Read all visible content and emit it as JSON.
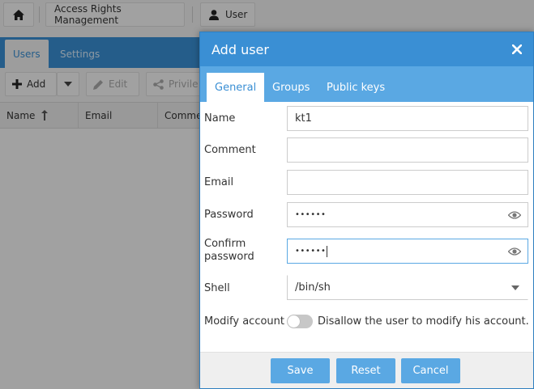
{
  "breadcrumb": {
    "home_icon": "home-icon",
    "section": "Access Rights Management",
    "current": "User",
    "current_icon": "user-icon"
  },
  "app_tabs": [
    {
      "label": "Users",
      "active": true
    },
    {
      "label": "Settings",
      "active": false
    }
  ],
  "toolbar": {
    "add_label": "Add",
    "edit_label": "Edit",
    "privileges_label": "Privile"
  },
  "table": {
    "columns": [
      "Name",
      "Email",
      "Comme"
    ]
  },
  "dialog": {
    "title": "Add user",
    "tabs": [
      {
        "label": "General",
        "active": true
      },
      {
        "label": "Groups",
        "active": false
      },
      {
        "label": "Public keys",
        "active": false
      }
    ],
    "fields": {
      "name": {
        "label": "Name",
        "value": "kt1"
      },
      "comment": {
        "label": "Comment",
        "value": ""
      },
      "email": {
        "label": "Email",
        "value": ""
      },
      "password": {
        "label": "Password",
        "value": "••••••"
      },
      "confirm_password": {
        "label_line1": "Confirm",
        "label_line2": "password",
        "value": "••••••"
      },
      "shell": {
        "label": "Shell",
        "value": "/bin/sh"
      },
      "modify_account": {
        "label": "Modify account",
        "toggle_on": false,
        "toggle_text": "Disallow the user to modify his account."
      }
    },
    "buttons": {
      "save": "Save",
      "reset": "Reset",
      "cancel": "Cancel"
    }
  },
  "colors": {
    "accent": "#3a8fd4",
    "tab_bar": "#5aa8e3",
    "button": "#5aa8e3"
  }
}
